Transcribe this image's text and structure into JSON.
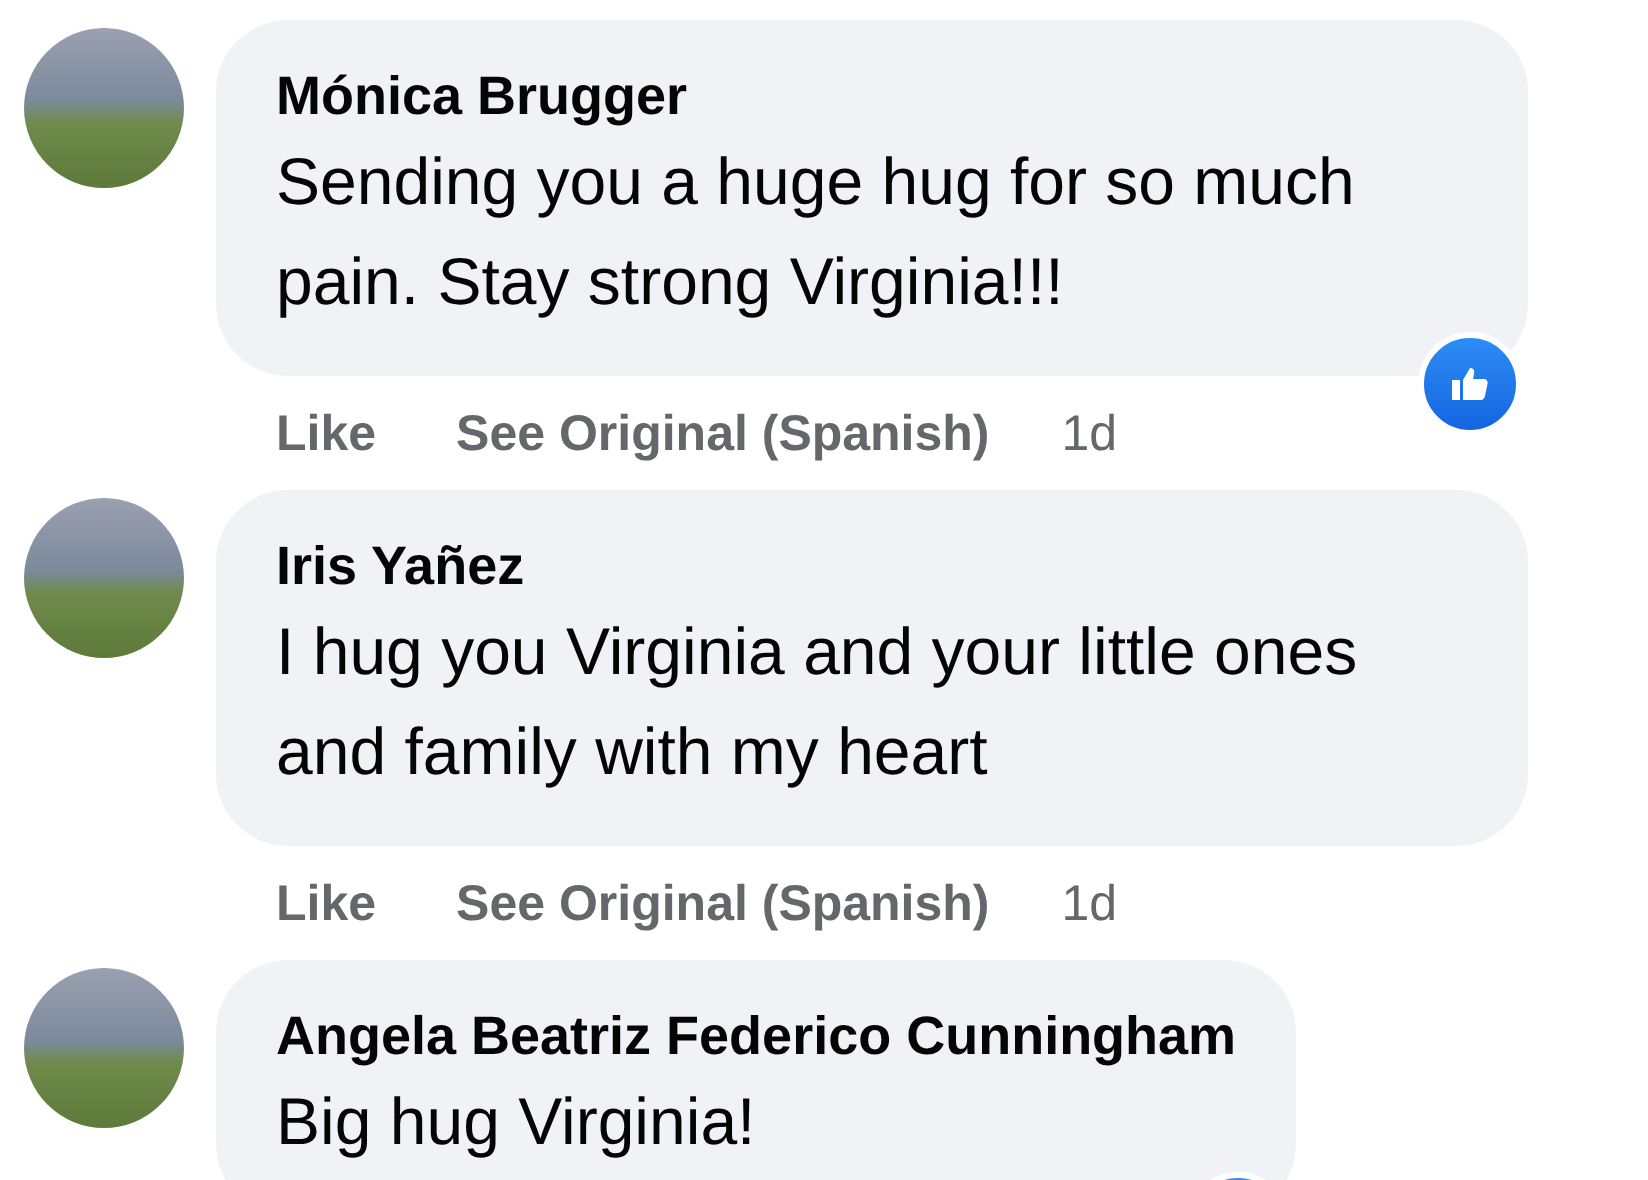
{
  "comments": [
    {
      "author": "Mónica Brugger",
      "text": "Sending you a huge hug for so much pain. Stay strong Virginia!!!",
      "liked": true,
      "actions": {
        "like": "Like",
        "translate": "See Original (Spanish)",
        "time": "1d"
      }
    },
    {
      "author": "Iris Yañez",
      "text": "I hug you Virginia and your little ones and family with my heart",
      "liked": false,
      "actions": {
        "like": "Like",
        "translate": "See Original (Spanish)",
        "time": "1d"
      }
    },
    {
      "author": "Angela Beatriz Federico Cunningham",
      "text": "Big hug Virginia!",
      "liked": true
    }
  ]
}
